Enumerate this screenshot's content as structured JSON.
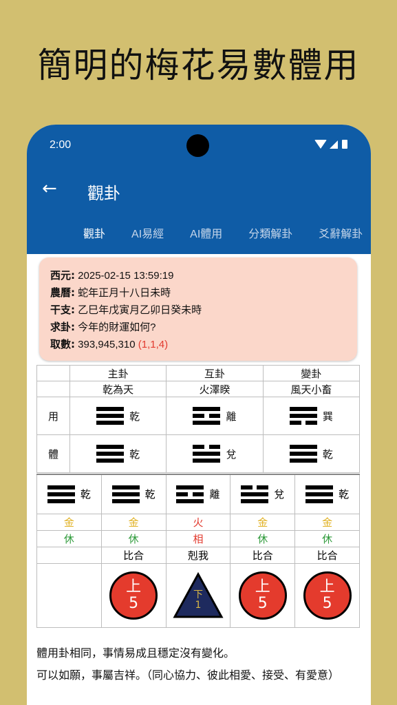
{
  "promo_title": "簡明的梅花易數體用",
  "status": {
    "time": "2:00"
  },
  "appbar": {
    "back_icon": "←",
    "title": "觀卦"
  },
  "tabs": [
    "觀卦",
    "AI易經",
    "AI體用",
    "分類解卦",
    "爻辭解卦"
  ],
  "info": {
    "rows": [
      {
        "label": "西元:",
        "value": "2025-02-15 13:59:19"
      },
      {
        "label": "農曆:",
        "value": "蛇年正月十八日未時"
      },
      {
        "label": "干支:",
        "value": "乙巳年戊寅月乙卯日癸未時"
      },
      {
        "label": "求卦:",
        "value": "今年的財運如何?"
      },
      {
        "label": "取數:",
        "value": "393,945,310",
        "extra": "(1,1,4)"
      }
    ]
  },
  "gua_table": {
    "headers": [
      "主卦",
      "互卦",
      "變卦"
    ],
    "names": [
      "乾為天",
      "火澤睽",
      "風天小畜"
    ],
    "yong_label": "用",
    "ti_label": "體",
    "yong": [
      "乾",
      "離",
      "巽"
    ],
    "ti": [
      "乾",
      "兌",
      "乾"
    ]
  },
  "relation_table": {
    "trigrams": [
      "乾",
      "乾",
      "離",
      "兌",
      "乾"
    ],
    "elements": [
      "金",
      "金",
      "火",
      "金",
      "金"
    ],
    "states": [
      "休",
      "休",
      "相",
      "休",
      "休"
    ],
    "relations": [
      "",
      "比合",
      "剋我",
      "比合",
      "比合"
    ],
    "badges": [
      {
        "type": "none"
      },
      {
        "type": "circle",
        "top": "上",
        "num": "5"
      },
      {
        "type": "triangle",
        "top": "下",
        "num": "1"
      },
      {
        "type": "circle",
        "top": "上",
        "num": "5"
      },
      {
        "type": "circle",
        "top": "上",
        "num": "5"
      }
    ],
    "colors": {
      "金": "#e0b020",
      "火": "#e23a2e",
      "休": "#2e9a3a",
      "相": "#e23a2e"
    }
  },
  "description": [
    "體用卦相同，事情易成且穩定沒有變化。",
    "可以如願，事屬吉祥。（同心協力、彼此相愛、接受、有愛意）"
  ],
  "colors": {
    "appbar": "#0f5ca6",
    "background": "#d2bf70",
    "info_card": "#fbd7ca"
  }
}
